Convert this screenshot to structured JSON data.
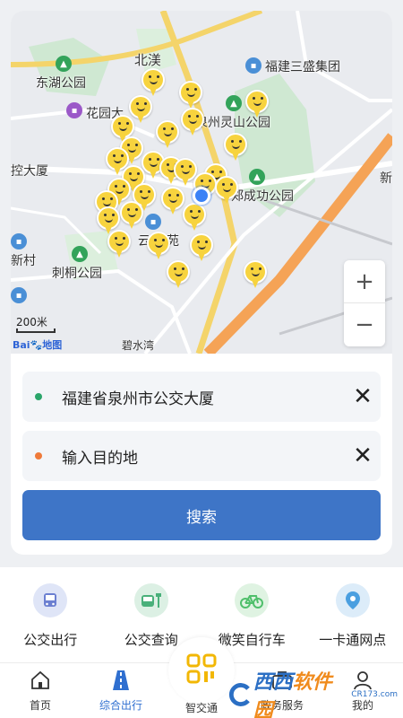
{
  "map": {
    "labels": {
      "beijiang": "北渼",
      "fujian_sansheng": "福建三盛集团",
      "donghu_park": "东湖公园",
      "huayuan": "花园大",
      "lingshan_park": "泉州灵山公园",
      "kong_tower": "控大厦",
      "chenggong_park": "郑成功公园",
      "xin_cun": "新村",
      "citong_park": "刺桐公园",
      "yungu": "云谷",
      "yuan": "苑",
      "xin": "新",
      "biyi": "碧水湾",
      "zheng": "郑",
      "cheng": "郑"
    },
    "scale_text": "200米",
    "baidu_logo": "Bai",
    "baidu_suffix": "地图",
    "zoom_in": "+",
    "zoom_out": "−"
  },
  "route": {
    "origin": "福建省泉州市公交大厦",
    "destination": "输入目的地",
    "clear_symbol": "✕",
    "origin_color": "#2aa56a",
    "destination_color": "#ef7a3a",
    "search_label": "搜索"
  },
  "services": [
    {
      "label": "公交出行",
      "icon": "bus-icon",
      "color": "#6b7fd1"
    },
    {
      "label": "公交查询",
      "icon": "bus-stop-icon",
      "color": "#49b07a"
    },
    {
      "label": "微笑自行车",
      "icon": "bicycle-icon",
      "color": "#4fbf6b"
    },
    {
      "label": "一卡通网点",
      "icon": "location-pin-icon",
      "color": "#4a9fe0"
    }
  ],
  "nav": {
    "home": "首页",
    "transport": "综合出行",
    "center": "智交通",
    "gov": "政务服务",
    "mine": "我的"
  },
  "watermark": {
    "brand_a": "西西",
    "brand_b": "软件园",
    "sub": "CR173.com"
  }
}
